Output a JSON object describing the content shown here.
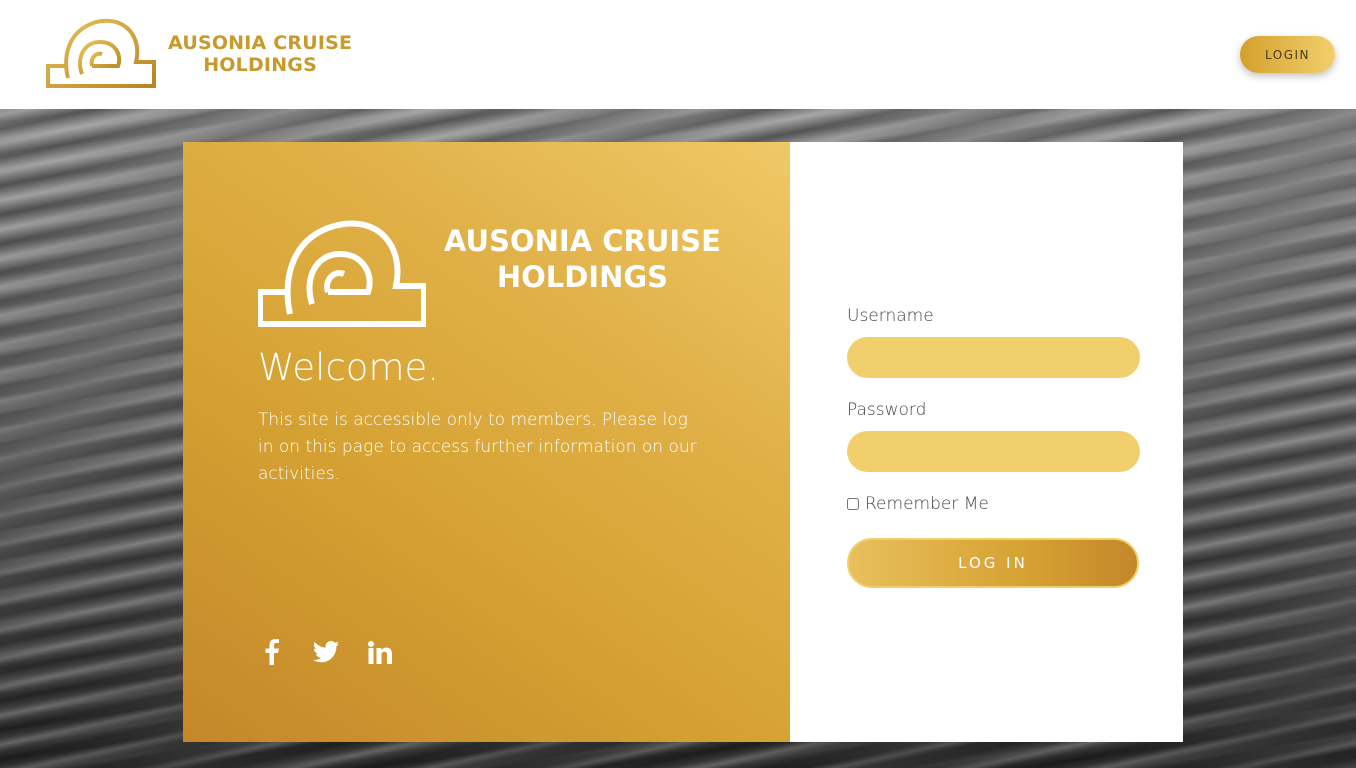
{
  "header": {
    "brand_line1": "AUSONIA CRUISE",
    "brand_line2": "HOLDINGS",
    "login_label": "LOGIN"
  },
  "card": {
    "brand_line1": "AUSONIA CRUISE",
    "brand_line2": "HOLDINGS",
    "welcome": "Welcome.",
    "intro": "This site is accessible only to members. Please log in on this page to access further information on our activities.",
    "social": [
      "facebook-icon",
      "twitter-icon",
      "linkedin-icon"
    ]
  },
  "form": {
    "username_label": "Username",
    "username_value": "",
    "password_label": "Password",
    "password_value": "",
    "remember_label": "Remember Me",
    "remember_checked": false,
    "submit_label": "LOG IN"
  },
  "colors": {
    "gold": "#c89a2c",
    "gold_light": "#f2cf6d",
    "gold_dark": "#c4872a"
  }
}
